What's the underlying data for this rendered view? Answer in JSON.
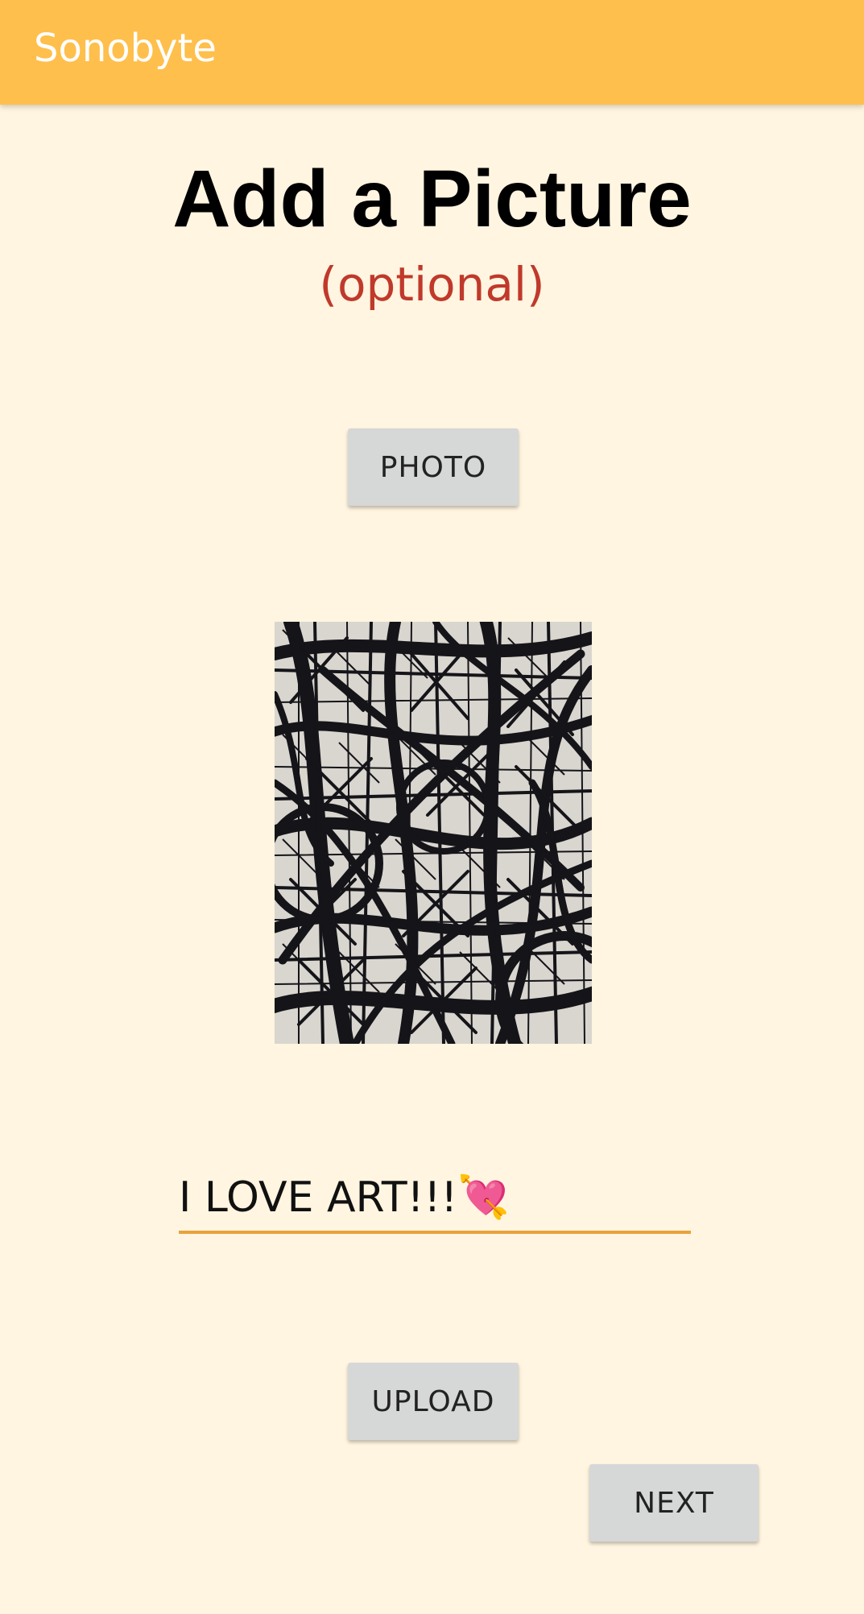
{
  "appbar": {
    "title": "Sonobyte"
  },
  "page": {
    "title": "Add a Picture",
    "subtitle": "(optional)"
  },
  "buttons": {
    "photo": "PHOTO",
    "upload": "UPLOAD",
    "next": "NEXT"
  },
  "caption": {
    "value": "I LOVE ART!!!💘"
  },
  "colors": {
    "appbar": "#FFBF4C",
    "background": "#FFF5E0",
    "subtitle": "#C0392B",
    "underline": "#E9A23B",
    "button": "#D6D7D7"
  }
}
